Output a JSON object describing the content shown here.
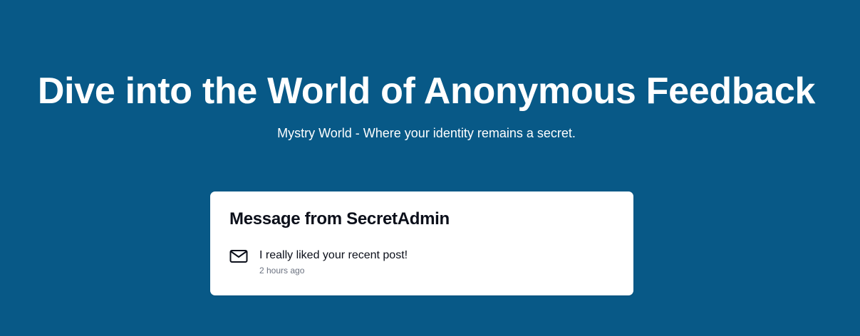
{
  "hero": {
    "title": "Dive into the World of Anonymous Feedback",
    "subtitle": "Mystry World - Where your identity remains a secret."
  },
  "message_card": {
    "title": "Message from SecretAdmin",
    "icon": "mail-icon",
    "message": "I really liked your recent post!",
    "time": "2 hours ago"
  },
  "colors": {
    "background": "#085987",
    "card": "#ffffff",
    "heading_text": "#0b0f1a",
    "muted_text": "#6b7280"
  }
}
